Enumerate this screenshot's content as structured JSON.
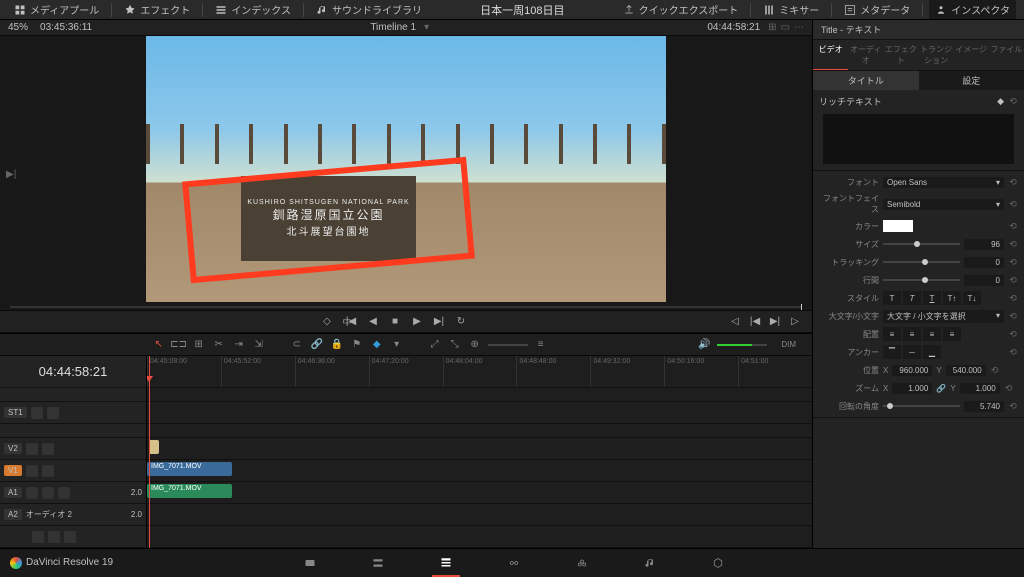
{
  "topbar": {
    "left": [
      {
        "label": "メディアプール",
        "icon": "media"
      },
      {
        "label": "エフェクト",
        "icon": "fx"
      },
      {
        "label": "インデックス",
        "icon": "index"
      },
      {
        "label": "サウンドライブラリ",
        "icon": "sound"
      }
    ],
    "project_title": "日本一周108日目",
    "right": [
      {
        "label": "クイックエクスポート",
        "icon": "export"
      },
      {
        "label": "ミキサー",
        "icon": "mixer"
      },
      {
        "label": "メタデータ",
        "icon": "meta"
      },
      {
        "label": "インスペクタ",
        "icon": "inspector",
        "active": true
      }
    ]
  },
  "viewer": {
    "zoom": "45%",
    "left_tc": "03:45:36:11",
    "timeline_name": "Timeline 1",
    "right_tc": "04:44:58:21",
    "sign_text1": "釧路湿原国立公園",
    "sign_text2": "北斗展望台園地"
  },
  "inspector": {
    "title": "Title - テキスト",
    "tabs": [
      "ビデオ",
      "オーディオ",
      "エフェクト",
      "トランジション",
      "イメージ",
      "ファイル"
    ],
    "active_tab": 0,
    "subtabs": [
      "タイトル",
      "設定"
    ],
    "active_subtab": 0,
    "section_label": "リッチテキスト",
    "font_label": "フォント",
    "font_value": "Open Sans",
    "face_label": "フォントフェイス",
    "face_value": "Semibold",
    "color_label": "カラー",
    "size_label": "サイズ",
    "size_value": "96",
    "tracking_label": "トラッキング",
    "tracking_value": "0",
    "linespace_label": "行間",
    "linespace_value": "0",
    "style_label": "スタイル",
    "case_label": "大文字/小文字",
    "case_value": "大文字 / 小文字を選択",
    "align_label": "配置",
    "anchor_label": "アンカー",
    "position_label": "位置",
    "pos_x": "960.000",
    "pos_y": "540.000",
    "zoom_label": "ズーム",
    "zoom_x": "1.000",
    "zoom_y": "1.000",
    "rotation_label": "回転の角度",
    "rotation_value": "5.740"
  },
  "timeline": {
    "timecode": "04:44:58:21",
    "ruler": [
      "04:45:08:00",
      "04:45:52:00",
      "04:46:36:00",
      "04:47:20:00",
      "04:48:04:00",
      "04:48:48:00",
      "04:49:32:00",
      "04:50:16:00",
      "04:51:00"
    ],
    "tracks": {
      "st1": "ST1",
      "v2": "V2",
      "v1": "V1",
      "a1": "A1",
      "a1_val": "2.0",
      "a2": "A2",
      "a2_name": "オーディオ 2",
      "a2_val": "2.0"
    },
    "clips": {
      "v1_clip": "IMG_7071.MOV",
      "a1_clip": "IMG_7071.MOV"
    },
    "dim_label": "DIM"
  },
  "bottombar": {
    "app_name": "DaVinci Resolve 19",
    "active_page": 3
  }
}
